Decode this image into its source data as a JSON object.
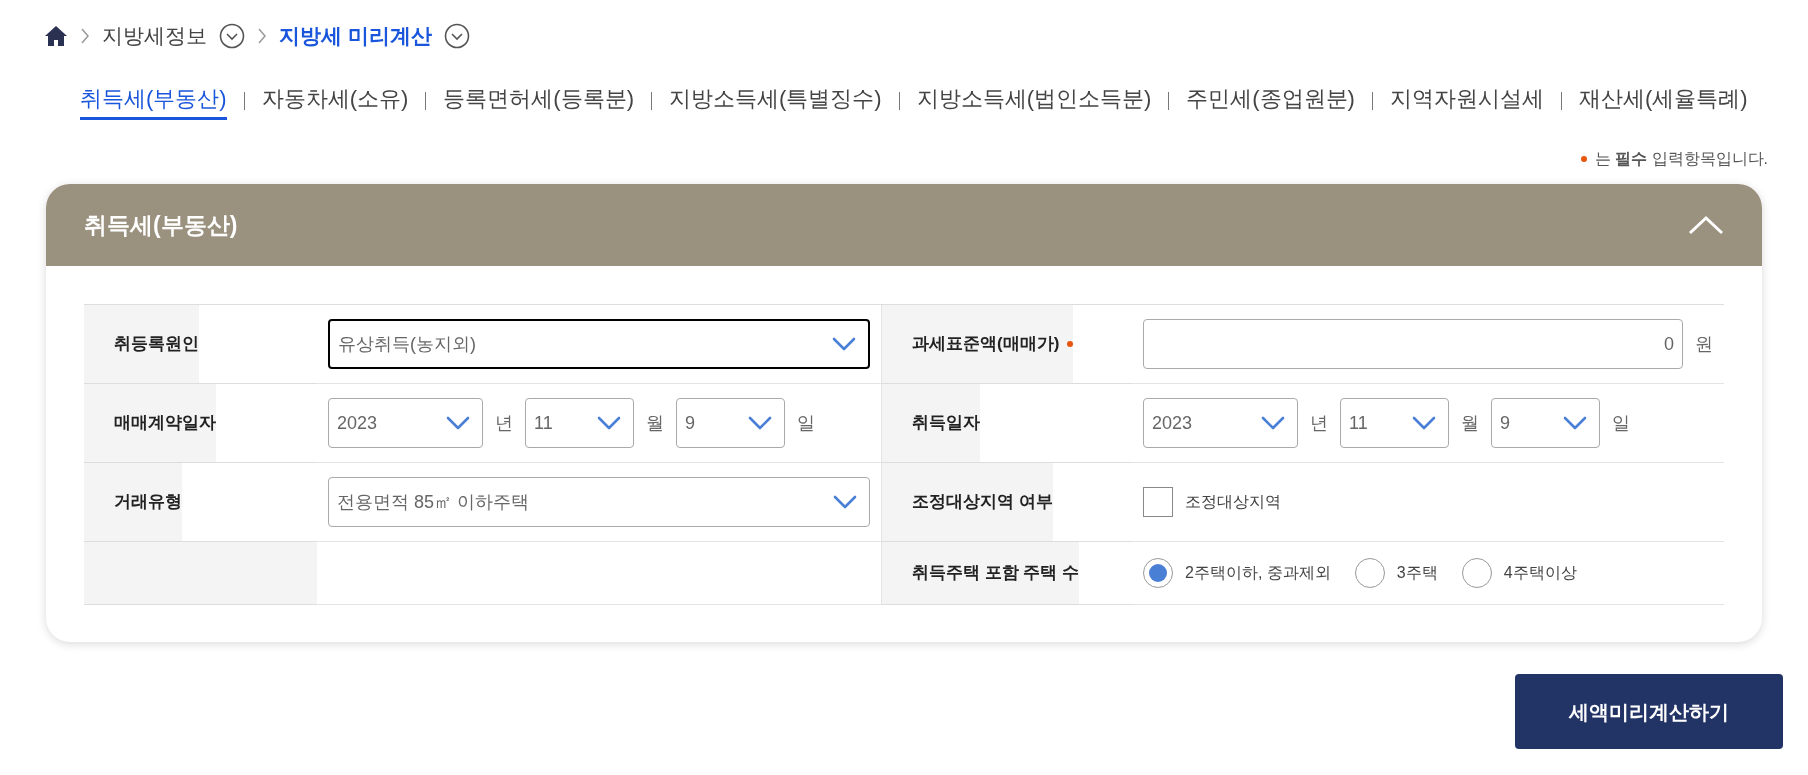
{
  "breadcrumb": [
    {
      "label": "지방세정보",
      "selected": false
    },
    {
      "label": "지방세 미리계산",
      "selected": true
    }
  ],
  "tabs": [
    {
      "label": "취득세(부동산)",
      "selected": true
    },
    {
      "label": "자동차세(소유)",
      "selected": false
    },
    {
      "label": "등록면허세(등록분)",
      "selected": false
    },
    {
      "label": "지방소득세(특별징수)",
      "selected": false
    },
    {
      "label": "지방소득세(법인소득분)",
      "selected": false
    },
    {
      "label": "주민세(종업원분)",
      "selected": false
    },
    {
      "label": "지역자원시설세",
      "selected": false
    },
    {
      "label": "재산세(세율특례)",
      "selected": false
    }
  ],
  "required_note": "는 **필수** 입력항목입니다.",
  "panel": {
    "title": "취득세(부동산)",
    "expanded": true,
    "rows": [
      {
        "cells": [
          {
            "kind": "select",
            "label": "취등록원인",
            "required": false,
            "value": "유상취득(농지외)",
            "focused": true
          },
          {
            "kind": "amount",
            "label": "과세표준액(매매가)",
            "required": true,
            "value": "0",
            "unit": "원"
          }
        ]
      },
      {
        "cells": [
          {
            "kind": "date",
            "label": "매매계약일자",
            "required": false,
            "parts": [
              {
                "value": "2023",
                "unit": "년"
              },
              {
                "value": "11",
                "unit": "월"
              },
              {
                "value": "9",
                "unit": "일"
              }
            ]
          },
          {
            "kind": "date",
            "label": "취득일자",
            "required": false,
            "parts": [
              {
                "value": "2023",
                "unit": "년"
              },
              {
                "value": "11",
                "unit": "월"
              },
              {
                "value": "9",
                "unit": "일"
              }
            ]
          }
        ]
      },
      {
        "cells": [
          {
            "kind": "select",
            "label": "거래유형",
            "required": false,
            "value": "전용면적 85㎡ 이하주택",
            "focused": false
          },
          {
            "kind": "checkbox",
            "label": "조정대상지역 여부",
            "required": false,
            "option": "조정대상지역",
            "checked": false
          }
        ]
      },
      {
        "cells": [
          {
            "kind": "blank"
          },
          {
            "kind": "radio",
            "label": "취득주택 포함 주택 수",
            "required": false,
            "options": [
              {
                "label": "2주택이하, 중과제외",
                "selected": true
              },
              {
                "label": "3주택",
                "selected": false
              },
              {
                "label": "4주택이상",
                "selected": false
              }
            ]
          }
        ]
      }
    ]
  },
  "submit": "세액미리계산하기"
}
